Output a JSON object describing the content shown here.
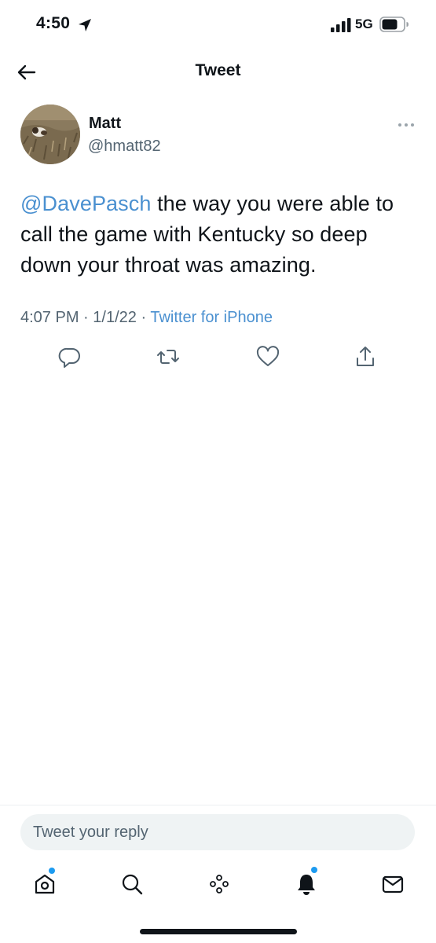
{
  "status_bar": {
    "time": "4:50",
    "network": "5G",
    "location_icon": "location-arrow-icon",
    "signal_icon": "cellular-signal-icon",
    "battery_icon": "battery-icon"
  },
  "header": {
    "title": "Tweet",
    "back_icon": "back-arrow-icon"
  },
  "tweet": {
    "author_name": "Matt",
    "author_handle": "@hmatt82",
    "mention": "@DavePasch",
    "text_rest": " the way you were able to call the game with Kentucky so deep down your throat was amazing.",
    "time": "4:07 PM",
    "separator": "·",
    "date": "1/1/22",
    "source": "Twitter for iPhone"
  },
  "actions": {
    "reply_icon": "reply-icon",
    "retweet_icon": "retweet-icon",
    "like_icon": "heart-icon",
    "share_icon": "share-icon"
  },
  "reply": {
    "placeholder": "Tweet your reply"
  },
  "tab_bar": {
    "items": [
      {
        "icon": "home-icon",
        "has_dot": true
      },
      {
        "icon": "search-icon",
        "has_dot": false
      },
      {
        "icon": "spaces-icon",
        "has_dot": false
      },
      {
        "icon": "notifications-icon",
        "has_dot": true
      },
      {
        "icon": "messages-icon",
        "has_dot": false
      }
    ]
  },
  "colors": {
    "accent": "#1d9bf0",
    "link": "#4a90d0",
    "secondary_text": "#536471",
    "text": "#0f1419"
  }
}
